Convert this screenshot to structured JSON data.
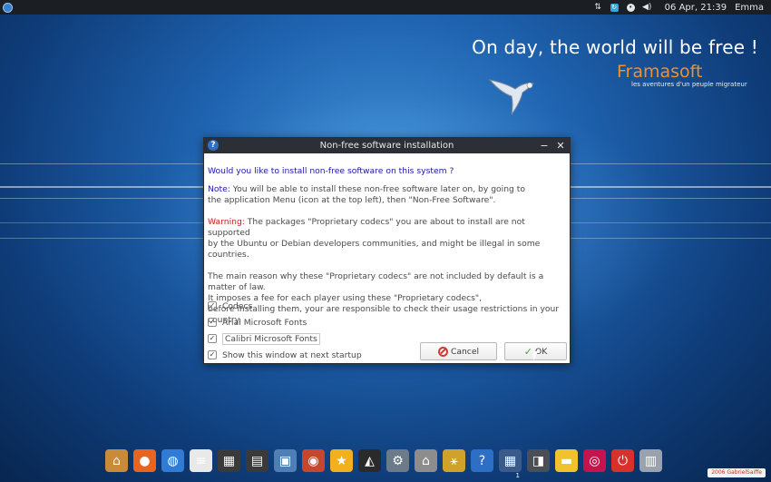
{
  "top_panel": {
    "menu_icon": "distro-logo-icon",
    "tray_icons": [
      "network-arrows-icon",
      "sync-icon",
      "notification-icon",
      "volume-icon"
    ],
    "clock": "06 Apr, 21:39",
    "user": "Emma"
  },
  "wallpaper": {
    "slogan": "On day, the world will be free !",
    "brand": "Framasoft",
    "brand_tagline": "les aventures d'un peuple migrateur"
  },
  "dialog": {
    "title": "Non-free software installation",
    "question": "Would you like to install non-free software on this system ?",
    "note_label": "Note:",
    "note_line1": " You will be able to install these non-free software later on, by going to",
    "note_line2": "the application Menu (icon at the top left), then \"Non-Free Software\".",
    "warning_label": "Warning:",
    "warning_line1": " The packages \"Proprietary codecs\" you are about to install are not supported",
    "warning_line2": "by the Ubuntu or Debian developers communities, and might be illegal in some countries.",
    "reason_line1": "The main reason why these \"Proprietary codecs\" are not included by default is a matter of law.",
    "reason_line2": "It imposes a fee for each player using these \"Proprietary codecs\",",
    "reason_line3": "before installing them, your are responsible to check their usage restrictions in your country.",
    "checkboxes": [
      {
        "label": "Codecs",
        "checked": true
      },
      {
        "label": "Arial Microsoft Fonts",
        "checked": true
      },
      {
        "label": "Calibri Microsoft Fonts",
        "checked": true
      },
      {
        "label": "Show this window at next startup",
        "checked": true
      }
    ],
    "cancel_label": "Cancel",
    "ok_label": "OK",
    "check_mark": "✓",
    "minimize_glyph": "−",
    "close_glyph": "✕",
    "help_glyph": "?"
  },
  "dock": {
    "items": [
      {
        "name": "home-folder-icon",
        "color": "#c98a3a",
        "glyph": "⌂"
      },
      {
        "name": "firefox-icon",
        "color": "#e8641f",
        "glyph": "●"
      },
      {
        "name": "web-browser-icon",
        "color": "#2f7bd6",
        "glyph": "◍"
      },
      {
        "name": "text-editor-icon",
        "color": "#e9e9e9",
        "glyph": "≡"
      },
      {
        "name": "video-editor-icon",
        "color": "#3a3a3a",
        "glyph": "▦"
      },
      {
        "name": "clapperboard-icon",
        "color": "#3a3a3a",
        "glyph": "▤"
      },
      {
        "name": "image-viewer-icon",
        "color": "#4f7fb5",
        "glyph": "▣"
      },
      {
        "name": "media-player-icon",
        "color": "#c9462e",
        "glyph": "◉"
      },
      {
        "name": "favorites-star-icon",
        "color": "#f2b01e",
        "glyph": "★"
      },
      {
        "name": "tux-linux-icon",
        "color": "#2a2a2a",
        "glyph": "◭"
      },
      {
        "name": "settings-gear-icon",
        "color": "#6c7a89",
        "glyph": "⚙"
      },
      {
        "name": "software-house-icon",
        "color": "#8d8d8d",
        "glyph": "⌂"
      },
      {
        "name": "network-tool-icon",
        "color": "#d0a22a",
        "glyph": "⚹"
      },
      {
        "name": "help-icon",
        "color": "#2e6fc6",
        "glyph": "?"
      },
      {
        "name": "workspace-switcher-icon",
        "color": "#3a5a8a",
        "glyph": "▦"
      },
      {
        "name": "window-manager-icon",
        "color": "#4a4f56",
        "glyph": "◨"
      },
      {
        "name": "notes-icon",
        "color": "#f2c12e",
        "glyph": "▬"
      },
      {
        "name": "debian-swirl-icon",
        "color": "#c7134d",
        "glyph": "◎"
      },
      {
        "name": "power-icon",
        "color": "#d8302a",
        "glyph": "⏻"
      },
      {
        "name": "trash-icon",
        "color": "#9aa3ad",
        "glyph": "▥"
      }
    ],
    "workspace_number": "1"
  },
  "corner_badge": "2006 GabrielSaiffe"
}
